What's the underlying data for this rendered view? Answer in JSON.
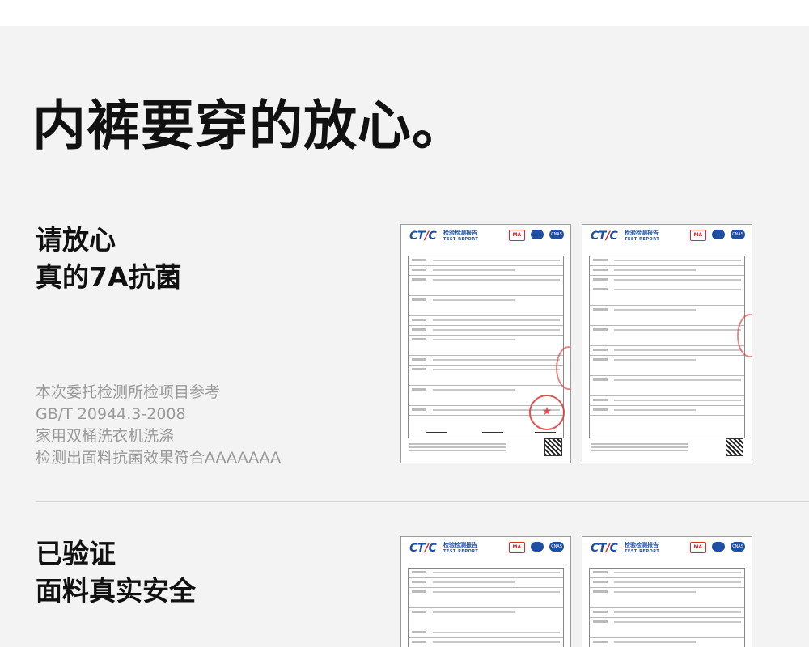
{
  "headline": "内裤要穿的放心。",
  "section1": {
    "title_line1": "请放心",
    "title_line2": "真的7A抗菌",
    "desc_line1": "本次委托检测所检项目参考",
    "desc_line2": "GB/T 20944.3-2008",
    "desc_line3": "家用双桶洗衣机洗涤",
    "desc_line4": "检测出面料抗菌效果符合AAAAAAA"
  },
  "section2": {
    "title_line1": "已验证",
    "title_line2": "面料真实安全"
  },
  "report": {
    "logo_a": "CT",
    "logo_b": "/",
    "logo_c": "C",
    "title_cn": "检验检测报告",
    "title_en": "TEST REPORT",
    "badge_ma": "MA",
    "badge_ilac": "ilac-MRA",
    "badge_cnas": "CNAS",
    "stamp_glyph": "★"
  },
  "colors": {
    "brand_blue": "#1f4fa0",
    "stamp_red": "#e03333",
    "desc_grey": "#9a9a9a"
  }
}
